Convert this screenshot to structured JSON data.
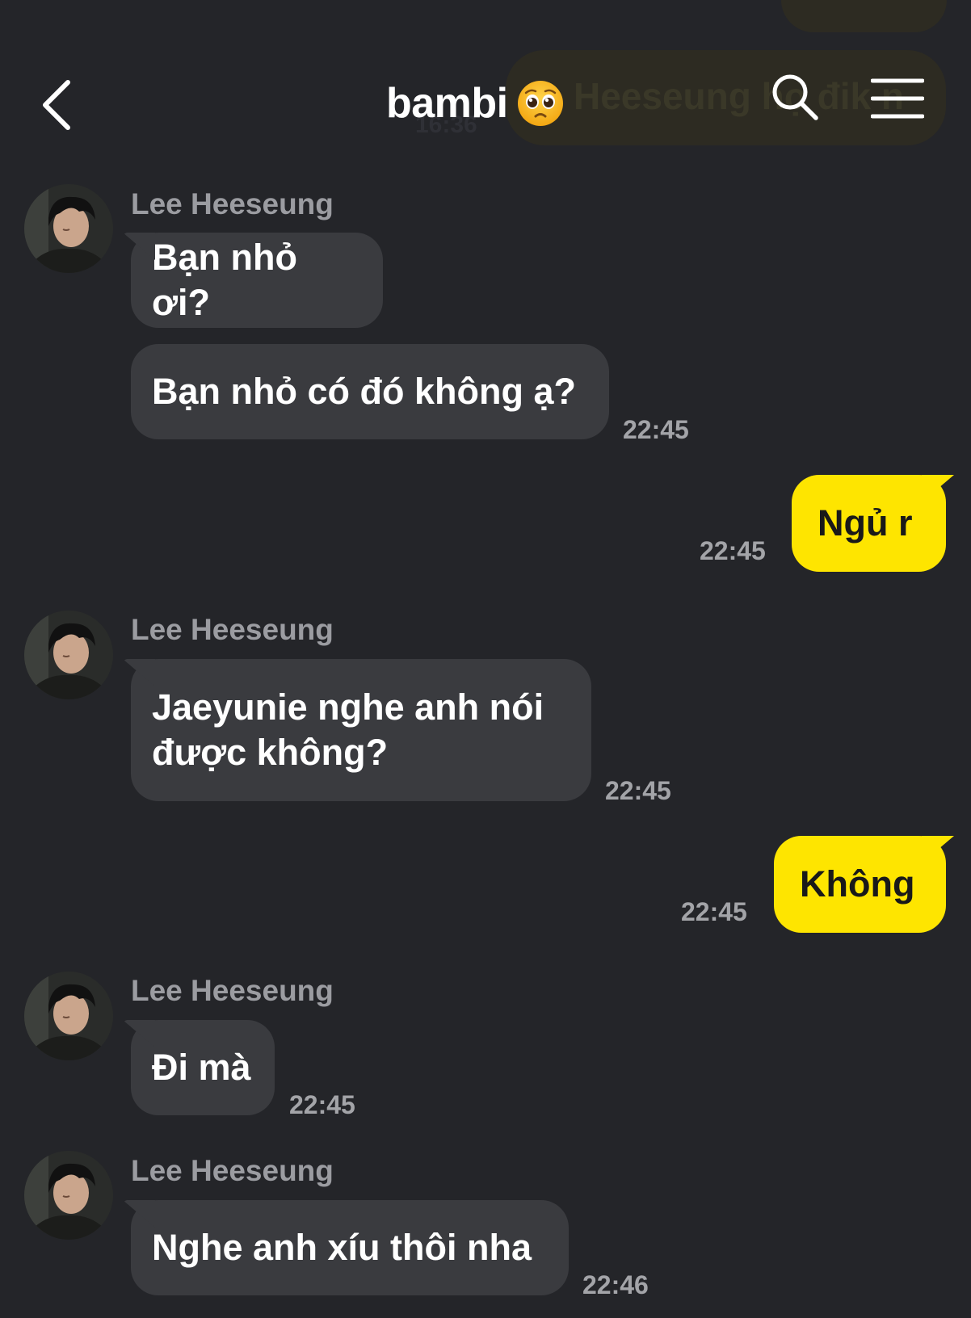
{
  "header": {
    "title": "bambi",
    "title_emoji": "pleading-face-emoji"
  },
  "background_ghost": {
    "bubble_text": "Heeseung họ đik n",
    "time": "16:36"
  },
  "colors": {
    "background": "#242529",
    "incoming_bubble": "#3a3b3f",
    "outgoing_bubble": "#fee500",
    "sender_name": "#9b9ca1",
    "timestamp": "#a3a4a8"
  },
  "messages": [
    {
      "sender": "Lee Heeseung",
      "bubbles": [
        "Bạn nhỏ ơi?",
        "Bạn nhỏ có đó không ạ?"
      ],
      "time": "22:45"
    },
    {
      "sender": "me",
      "bubbles": [
        "Ngủ r"
      ],
      "time": "22:45"
    },
    {
      "sender": "Lee Heeseung",
      "bubbles": [
        "Jaeyunie nghe anh nói\nđược không?"
      ],
      "time": "22:45"
    },
    {
      "sender": "me",
      "bubbles": [
        "Không"
      ],
      "time": "22:45"
    },
    {
      "sender": "Lee Heeseung",
      "bubbles": [
        "Đi mà"
      ],
      "time": "22:45"
    },
    {
      "sender": "Lee Heeseung",
      "bubbles": [
        "Nghe anh xíu thôi nha"
      ],
      "time": "22:46"
    }
  ]
}
